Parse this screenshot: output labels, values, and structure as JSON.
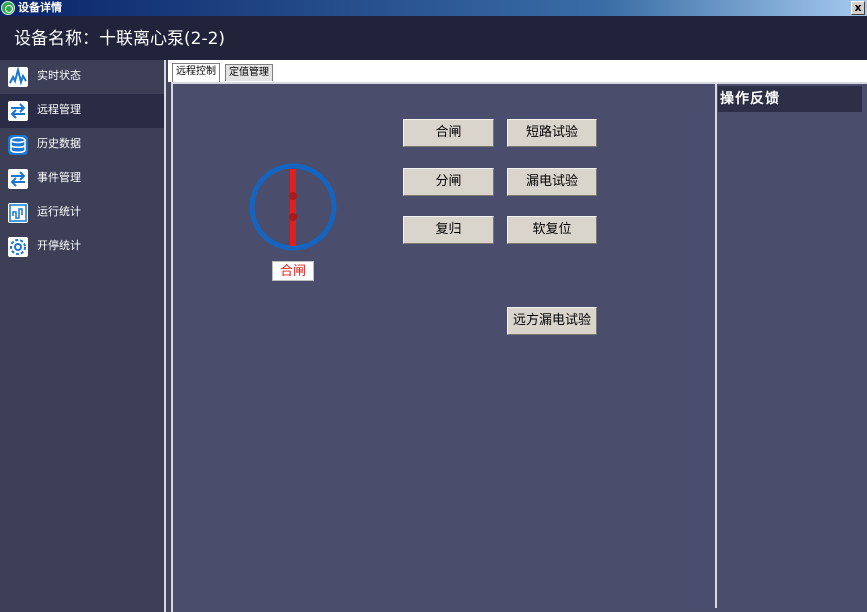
{
  "window": {
    "title": "设备详情",
    "close_label": "x"
  },
  "header": {
    "device_name": "设备名称：十联离心泵(2-2)"
  },
  "sidebar": {
    "items": [
      {
        "label": "实时状态",
        "icon": "waveform-icon"
      },
      {
        "label": "远程管理",
        "icon": "arrows-exchange-icon"
      },
      {
        "label": "历史数据",
        "icon": "database-icon"
      },
      {
        "label": "事件管理",
        "icon": "arrows-exchange-icon"
      },
      {
        "label": "运行统计",
        "icon": "chart-icon"
      },
      {
        "label": "开停统计",
        "icon": "gear-icon"
      }
    ],
    "active_index": 1
  },
  "tabs": [
    {
      "label": "远程控制",
      "active": true
    },
    {
      "label": "定值管理",
      "active": false
    }
  ],
  "breaker": {
    "status_label": "合闸",
    "status_color": "#e02020",
    "ring_color": "#1565c0"
  },
  "buttons": {
    "close": "合闸",
    "short_test": "短路试验",
    "open": "分闸",
    "leak_test": "漏电试验",
    "reset": "复归",
    "soft_reset": "软复位",
    "remote_leak_test": "远方漏电试验"
  },
  "feedback": {
    "title": "操作反馈"
  }
}
